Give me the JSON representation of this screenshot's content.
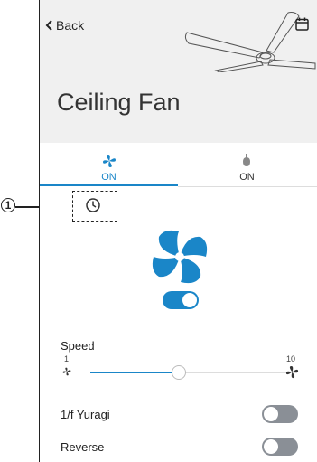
{
  "header": {
    "back_label": "Back",
    "title": "Ceiling Fan"
  },
  "tabs": [
    {
      "label": "ON",
      "icon": "fan-icon",
      "selected": true
    },
    {
      "label": "ON",
      "icon": "light-bulb-icon",
      "selected": false
    }
  ],
  "main_toggle": {
    "state": "on"
  },
  "speed": {
    "label": "Speed",
    "min_label": "1",
    "max_label": "10",
    "value": 5,
    "min": 1,
    "max": 10
  },
  "settings": [
    {
      "label": "1/f Yuragi",
      "state": "off"
    },
    {
      "label": "Reverse",
      "state": "off"
    }
  ],
  "annotation": {
    "number": "1"
  },
  "colors": {
    "accent": "#1a86c8",
    "header_bg": "#f0f0f0",
    "toggle_off": "#8a8f96"
  }
}
